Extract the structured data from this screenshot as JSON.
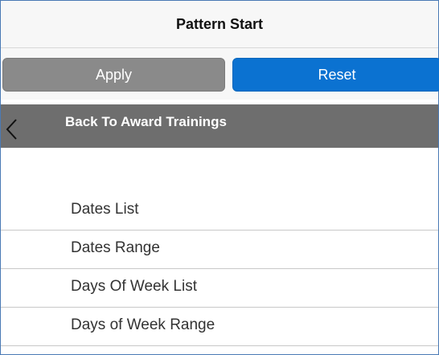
{
  "header": {
    "title": "Pattern Start"
  },
  "actions": {
    "apply_label": "Apply",
    "reset_label": "Reset"
  },
  "nav": {
    "back_label": "Back To Award Trainings",
    "back_icon": "chevron-left-icon"
  },
  "options": [
    {
      "label": "Dates List"
    },
    {
      "label": "Dates Range"
    },
    {
      "label": "Days Of Week List"
    },
    {
      "label": "Days of Week Range"
    }
  ],
  "colors": {
    "apply_button": "#8a8a8a",
    "reset_button": "#0b72d1",
    "back_bar": "#6e6e6e",
    "header_bg": "#f7f7f7"
  }
}
